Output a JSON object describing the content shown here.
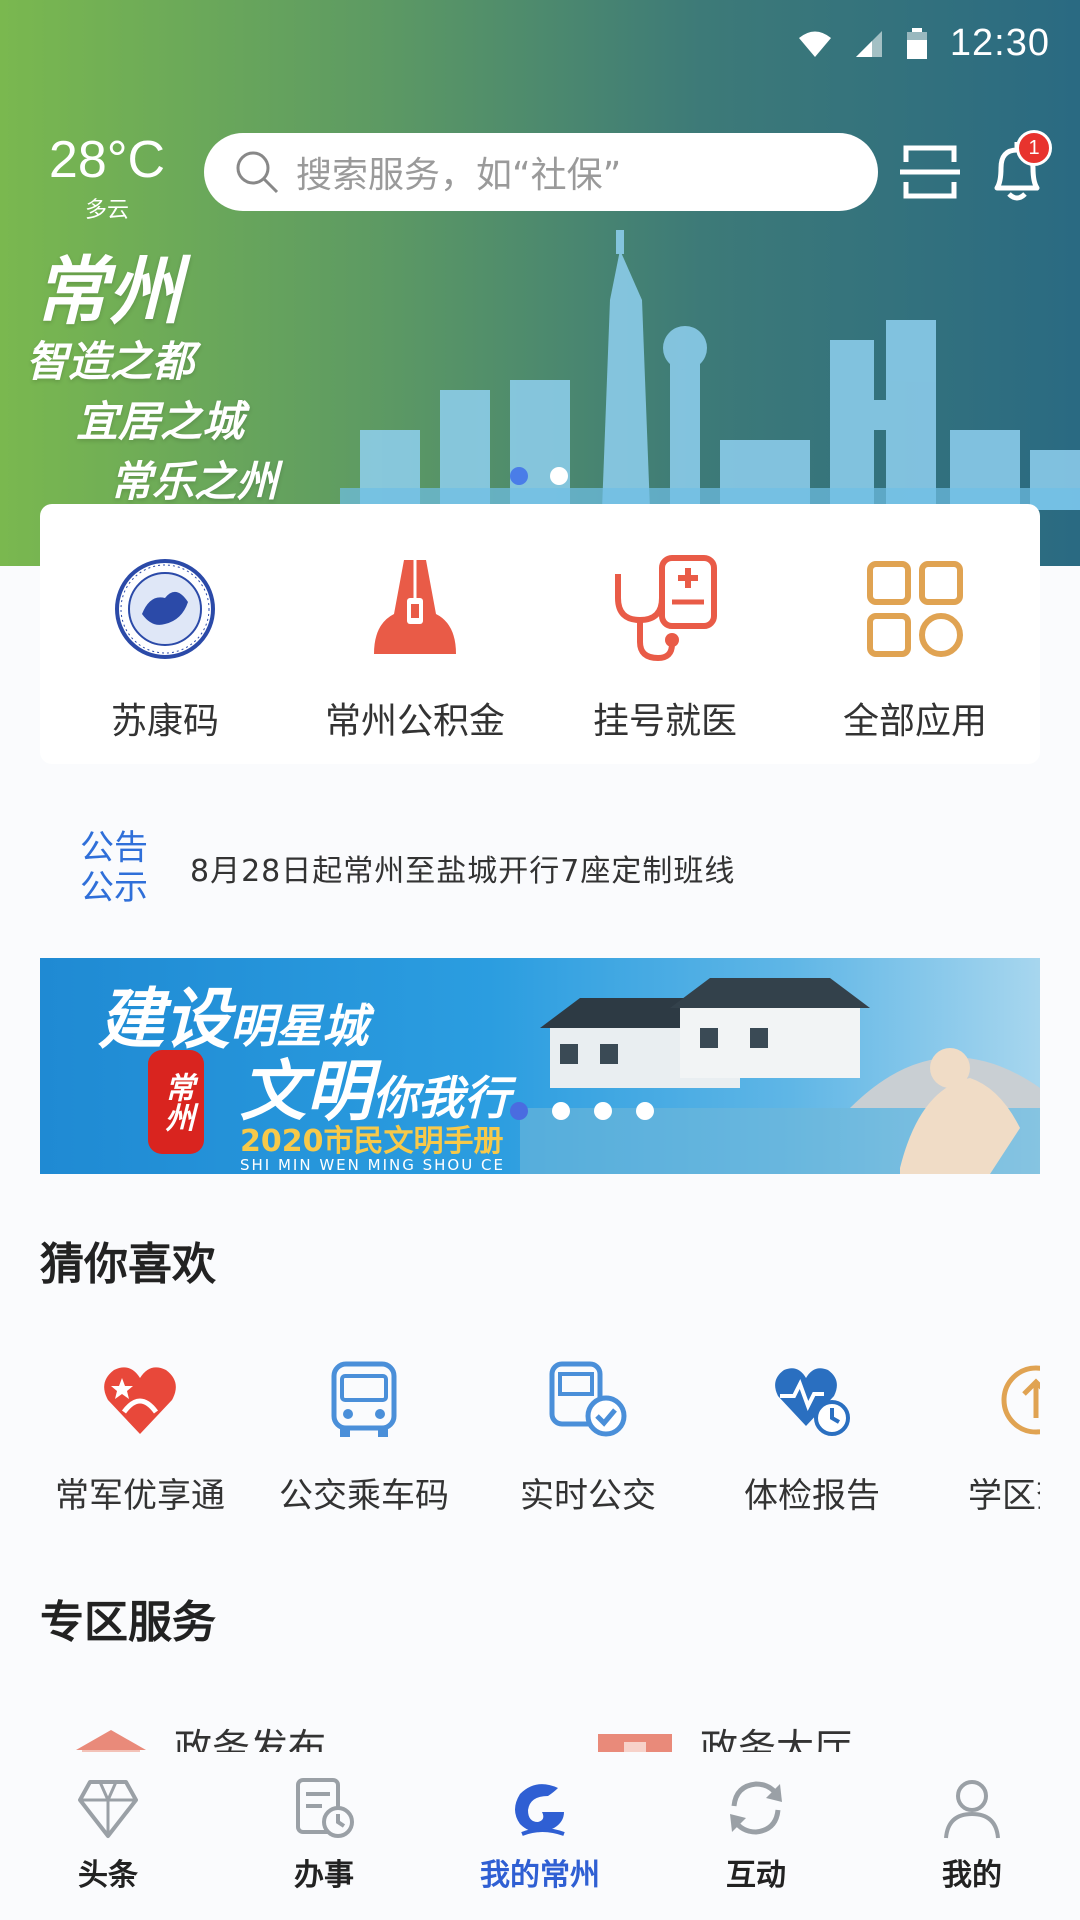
{
  "status_bar": {
    "time": "12:30"
  },
  "header": {
    "weather": {
      "temperature": "28°C",
      "condition": "多云"
    },
    "search": {
      "placeholder": "搜索服务，如“社保”"
    },
    "notification_count": "1"
  },
  "hero_banner": {
    "city": "常州",
    "lines": [
      "智造之都",
      "宜居之城",
      "常乐之州"
    ],
    "slide_count": 2,
    "active_slide": 1
  },
  "quick_apps": [
    {
      "label": "苏康码",
      "icon": "health-code-emblem-icon"
    },
    {
      "label": "常州公积金",
      "icon": "housing-fund-icon"
    },
    {
      "label": "挂号就医",
      "icon": "stethoscope-icon"
    },
    {
      "label": "全部应用",
      "icon": "all-apps-grid-icon"
    }
  ],
  "notice": {
    "tag_line1": "公告",
    "tag_line2": "公示",
    "text": "8月28日起常州至盐城开行7座定制班线"
  },
  "promo_banner": {
    "line1_big": "建设",
    "line1_small": "明星城",
    "line2_big": "文明",
    "line2_small": "你我行",
    "seal": "常州",
    "subtitle": "2020市民文明手册",
    "pinyin": "SHI MIN WEN MING SHOU CE",
    "slide_count": 4,
    "active_slide": 1
  },
  "guess_section": {
    "title": "猜你喜欢",
    "items": [
      {
        "label": "常军优享通",
        "icon": "military-heart-icon"
      },
      {
        "label": "公交乘车码",
        "icon": "bus-icon"
      },
      {
        "label": "实时公交",
        "icon": "realtime-bus-icon"
      },
      {
        "label": "体检报告",
        "icon": "health-report-icon"
      },
      {
        "label": "学区查询",
        "icon": "school-district-icon"
      }
    ]
  },
  "zone_section": {
    "title": "专区服务",
    "items": [
      {
        "label": "政务发布"
      },
      {
        "label": "政务大厅"
      }
    ]
  },
  "tab_bar": [
    {
      "label": "头条",
      "icon": "diamond-icon"
    },
    {
      "label": "办事",
      "icon": "task-clock-icon"
    },
    {
      "label": "我的常州",
      "icon": "changzhou-logo-icon",
      "active": true
    },
    {
      "label": "互动",
      "icon": "refresh-icon"
    },
    {
      "label": "我的",
      "icon": "user-icon"
    }
  ],
  "colors": {
    "accent": "#2f5fd3",
    "notice_tag": "#2f6fd9",
    "hero_start": "#7ab84f",
    "hero_end": "#2a6a82",
    "badge": "#e8332e"
  }
}
